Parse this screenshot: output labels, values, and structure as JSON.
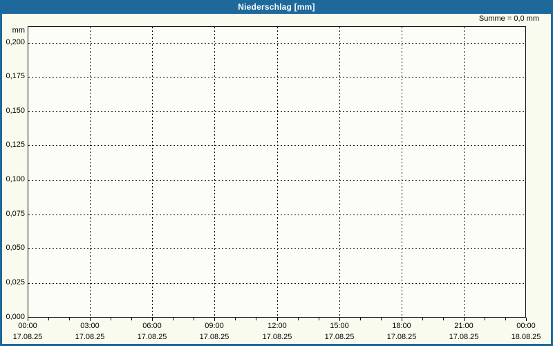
{
  "window": {
    "title": "Niederschlag [mm]",
    "summary_label": "Summe = 0,0 mm",
    "colors": {
      "accent": "#1e699c",
      "background": "#f9fbef",
      "plot_background": "#fdfdf8",
      "grid": "#000000",
      "text": "#000000",
      "title_text": "#ffffff"
    }
  },
  "chart_data": {
    "type": "line",
    "title": "Niederschlag [mm]",
    "ylabel": "mm",
    "annotation": "Summe = 0,0 mm",
    "grid": "dashed",
    "legend": "none",
    "x_axis": {
      "range_hours": [
        0,
        24
      ],
      "major_step_hours": 3,
      "minor_step_hours": 1,
      "ticks": [
        {
          "hour": 0,
          "time": "00:00",
          "date": "17.08.25"
        },
        {
          "hour": 3,
          "time": "03:00",
          "date": "17.08.25"
        },
        {
          "hour": 6,
          "time": "06:00",
          "date": "17.08.25"
        },
        {
          "hour": 9,
          "time": "09:00",
          "date": "17.08.25"
        },
        {
          "hour": 12,
          "time": "12:00",
          "date": "17.08.25"
        },
        {
          "hour": 15,
          "time": "15:00",
          "date": "17.08.25"
        },
        {
          "hour": 18,
          "time": "18:00",
          "date": "17.08.25"
        },
        {
          "hour": 21,
          "time": "21:00",
          "date": "17.08.25"
        },
        {
          "hour": 24,
          "time": "00:00",
          "date": "18.08.25"
        }
      ]
    },
    "y_axis": {
      "unit": "mm",
      "ylim": [
        0,
        0.212
      ],
      "ticks": [
        {
          "label": "0,200",
          "value": 0.2
        },
        {
          "label": "0,175",
          "value": 0.175
        },
        {
          "label": "0,150",
          "value": 0.15
        },
        {
          "label": "0,125",
          "value": 0.125
        },
        {
          "label": "0,100",
          "value": 0.1
        },
        {
          "label": "0,075",
          "value": 0.075
        },
        {
          "label": "0,050",
          "value": 0.05
        },
        {
          "label": "0,025",
          "value": 0.025
        },
        {
          "label": "0,000",
          "value": 0.0
        }
      ]
    },
    "series": []
  }
}
